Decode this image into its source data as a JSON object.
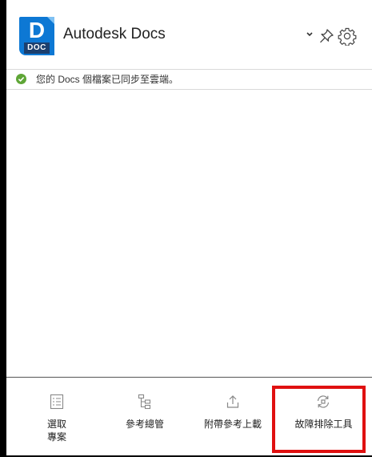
{
  "header": {
    "logo_letter": "D",
    "logo_badge": "DOC",
    "title": "Autodesk Docs",
    "icons": [
      "chevron-down-icon",
      "pin-icon",
      "gear-icon"
    ]
  },
  "status": {
    "icon": "check-circle-icon",
    "message": "您的 Docs 個檔案已同步至雲端。",
    "color": "#5fa637"
  },
  "toolbar": {
    "items": [
      {
        "label": "選取\n專案",
        "icon": "list-icon"
      },
      {
        "label": "參考總管",
        "icon": "hierarchy-icon"
      },
      {
        "label": "附帶參考上載",
        "icon": "upload-icon"
      },
      {
        "label": "故障排除工具",
        "icon": "sync-icon"
      }
    ]
  },
  "colors": {
    "brand_blue": "#0d78d4",
    "badge_navy": "#1c3f6e",
    "highlight_red": "#e01010"
  }
}
